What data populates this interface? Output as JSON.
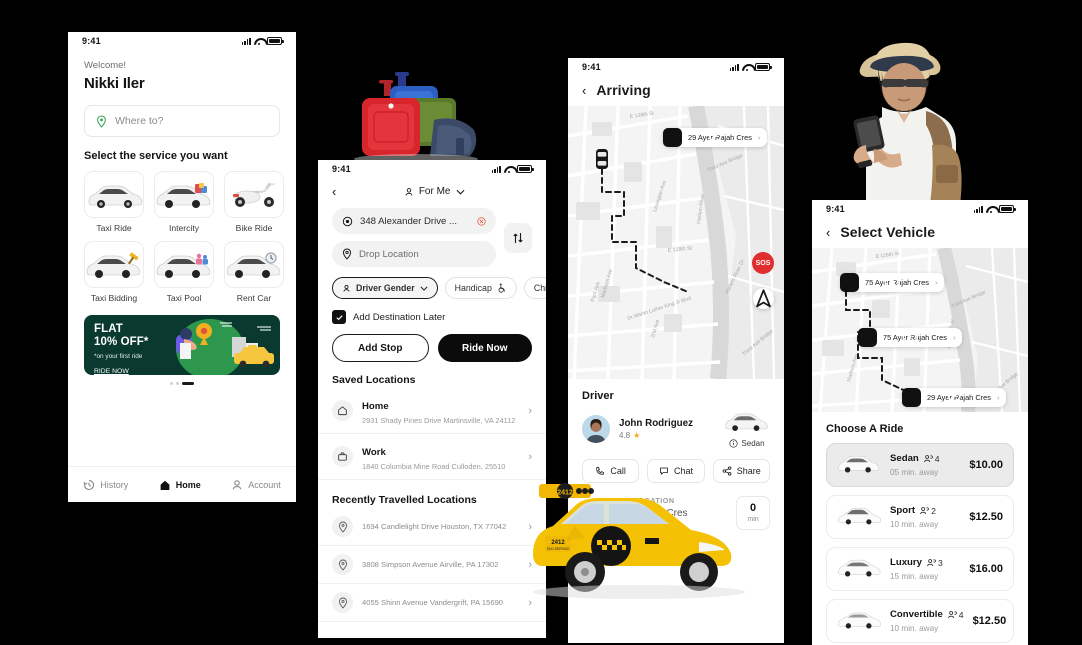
{
  "status_bar": {
    "time": "9:41"
  },
  "phone1": {
    "welcome": "Welcome!",
    "user_name": "Nikki Iler",
    "search_placeholder": "Where to?",
    "section_title": "Select the service you want",
    "services": [
      {
        "label": "Taxi Ride",
        "icon": "sedan-car-icon"
      },
      {
        "label": "Intercity",
        "icon": "car-with-luggage-icon"
      },
      {
        "label": "Bike Ride",
        "icon": "scooter-icon"
      },
      {
        "label": "Taxi Bidding",
        "icon": "car-with-auction-icon"
      },
      {
        "label": "Taxi Pool",
        "icon": "car-with-people-icon"
      },
      {
        "label": "Rent Car",
        "icon": "car-with-clock-icon"
      }
    ],
    "promo": {
      "line1": "FLAT",
      "line2": "10% OFF*",
      "sub": "*on your first ride",
      "cta": "RIDE NOW",
      "bg": "#09392f"
    },
    "tabs": [
      {
        "label": "History",
        "icon": "history-clock-icon",
        "active": false
      },
      {
        "label": "Home",
        "icon": "home-icon",
        "active": true
      },
      {
        "label": "Account",
        "icon": "person-icon",
        "active": false
      }
    ]
  },
  "phone2": {
    "rider_selector": "For Me",
    "pickup_value": "348 Alexander Drive ...",
    "drop_placeholder": "Drop Location",
    "chips": [
      {
        "label": "Driver Gender",
        "icon": "person-icon",
        "selected": true
      },
      {
        "label": "Handicap",
        "icon": "wheelchair-icon",
        "selected": false
      },
      {
        "label": "Child",
        "icon": "child-icon",
        "selected": false
      }
    ],
    "checkbox_label": "Add Destination Later",
    "checkbox_checked": true,
    "btn_add_stop": "Add Stop",
    "btn_ride_now": "Ride Now",
    "saved_title": "Saved Locations",
    "saved": [
      {
        "title": "Home",
        "address": "2931 Shady Pines Drive Martinsville, VA 24112",
        "icon": "home-icon"
      },
      {
        "title": "Work",
        "address": "1840 Columbia Mine Road Culloden, 25510",
        "icon": "briefcase-icon"
      }
    ],
    "recent_title": "Recently Travelled Locations",
    "recent": [
      {
        "address": "1694 Candlelight Drive Houston, TX 77042",
        "icon": "pin-icon"
      },
      {
        "address": "3808 Simpson Avenue Airville, PA 17302",
        "icon": "pin-icon"
      },
      {
        "address": "4055 Shinn Avenue Vandergrift, PA 15690",
        "icon": "pin-icon"
      }
    ]
  },
  "phone3": {
    "title": "Arriving",
    "map_pill": "29 Ayer Rajah Cres",
    "sos_label": "SOS",
    "driver_header": "Driver",
    "driver_name": "John Rodriguez",
    "driver_rating": "4.8",
    "vehicle_type": "Sedan",
    "actions": [
      {
        "label": "Call",
        "icon": "phone-icon"
      },
      {
        "label": "Chat",
        "icon": "chat-icon"
      },
      {
        "label": "Share",
        "icon": "share-icon"
      }
    ],
    "pickup_label": "PICKUP LOCATION",
    "pickup_address": "75 Ayer Rajah Cres",
    "eta_value": "0",
    "eta_unit": "min"
  },
  "phone4": {
    "title": "Select Vehicle",
    "map_pills": [
      {
        "text": "75 Ayer Rajah Cres",
        "icon": "pickup-target-icon"
      },
      {
        "text": "75 Ayer Rajah Cres",
        "icon": "stop-icon"
      },
      {
        "text": "29 Ayer Rajah Cres",
        "icon": "destination-pin-icon"
      }
    ],
    "choose_title": "Choose A Ride",
    "rides": [
      {
        "name": "Sedan",
        "seats": "4",
        "eta": "05 min. away",
        "price": "$10.00",
        "selected": true
      },
      {
        "name": "Sport",
        "seats": "2",
        "eta": "10 min. away",
        "price": "$12.50",
        "selected": false
      },
      {
        "name": "Luxury",
        "seats": "3",
        "eta": "15 min. away",
        "price": "$16.00",
        "selected": false
      },
      {
        "name": "Convertible",
        "seats": "4",
        "eta": "10 min. away",
        "price": "$12.50",
        "selected": false
      }
    ]
  }
}
